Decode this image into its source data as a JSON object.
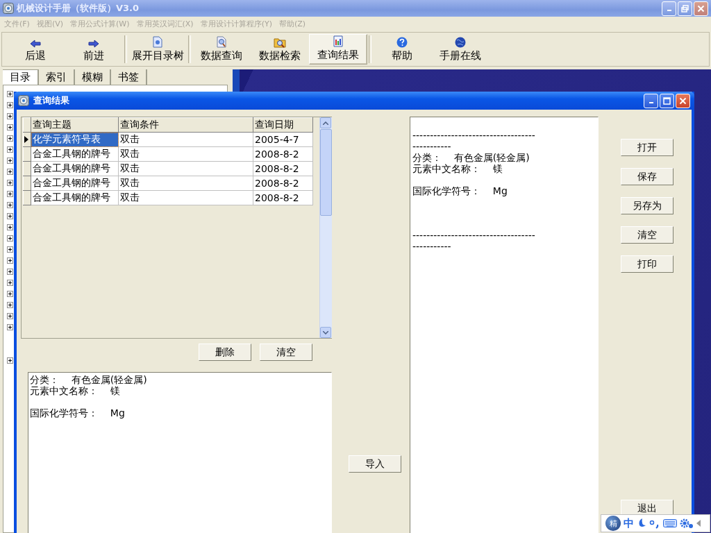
{
  "window": {
    "title": "机械设计手册（软件版）V3.0"
  },
  "menu": [
    {
      "label": "文件(F)",
      "disabled": true
    },
    {
      "label": "视图(V)",
      "disabled": true
    },
    {
      "label": "常用公式计算(W)",
      "disabled": true
    },
    {
      "label": "常用英汉词汇(X)",
      "disabled": true
    },
    {
      "label": "常用设计计算程序(Y)",
      "disabled": true
    },
    {
      "label": "帮助(Z)",
      "disabled": true
    }
  ],
  "toolbar": [
    {
      "label": "后退",
      "kind": "back",
      "selected": false,
      "separated": false
    },
    {
      "label": "前进",
      "kind": "forward",
      "selected": false,
      "separated": false
    },
    {
      "label": "展开目录树",
      "kind": "tree",
      "selected": false,
      "separated": true
    },
    {
      "label": "数据查询",
      "kind": "query",
      "selected": false,
      "separated": true
    },
    {
      "label": "数据检索",
      "kind": "search",
      "selected": false,
      "separated": false
    },
    {
      "label": "查询结果",
      "kind": "results",
      "selected": true,
      "separated": false
    },
    {
      "label": "帮助",
      "kind": "help",
      "selected": false,
      "separated": true
    },
    {
      "label": "手册在线",
      "kind": "online",
      "selected": false,
      "separated": false
    }
  ],
  "side_tabs": [
    {
      "label": "目录",
      "selected": true
    },
    {
      "label": "索引",
      "selected": false
    },
    {
      "label": "模糊",
      "selected": false
    },
    {
      "label": "书签",
      "selected": false
    }
  ],
  "tree": [
    {
      "kind": "node",
      "expanded": false
    },
    {
      "kind": "node",
      "expanded": false
    },
    {
      "kind": "node",
      "expanded": false
    },
    {
      "kind": "node",
      "expanded": false
    },
    {
      "kind": "node",
      "expanded": false
    },
    {
      "kind": "node",
      "expanded": false
    },
    {
      "kind": "node",
      "expanded": false
    },
    {
      "kind": "node",
      "expanded": false
    },
    {
      "kind": "node",
      "expanded": false
    },
    {
      "kind": "node",
      "expanded": false
    },
    {
      "kind": "node",
      "expanded": false
    },
    {
      "kind": "node",
      "expanded": false
    },
    {
      "kind": "node",
      "expanded": false
    },
    {
      "kind": "node",
      "expanded": false
    },
    {
      "kind": "node",
      "expanded": false
    },
    {
      "kind": "node",
      "expanded": false
    },
    {
      "kind": "node",
      "expanded": false
    },
    {
      "kind": "node",
      "expanded": false
    },
    {
      "kind": "node",
      "expanded": false
    },
    {
      "kind": "node",
      "expanded": false
    },
    {
      "kind": "node",
      "expanded": false
    },
    {
      "kind": "node",
      "expanded": false
    },
    {
      "kind": "leaf"
    },
    {
      "kind": "leaf"
    },
    {
      "kind": "node",
      "expanded": false
    }
  ],
  "dialog": {
    "title": "查询结果",
    "table": {
      "columns": [
        "查询主题",
        "查询条件",
        "查询日期"
      ],
      "rows": [
        {
          "cells": [
            "化学元素符号表",
            "双击",
            "2005-4-7"
          ],
          "selected": true
        },
        {
          "cells": [
            "合金工具钢的牌号",
            "双击",
            "2008-8-2"
          ],
          "selected": false
        },
        {
          "cells": [
            "合金工具钢的牌号",
            "双击",
            "2008-8-2"
          ],
          "selected": false
        },
        {
          "cells": [
            "合金工具钢的牌号",
            "双击",
            "2008-8-2"
          ],
          "selected": false
        },
        {
          "cells": [
            "合金工具钢的牌号",
            "双击",
            "2008-8-2"
          ],
          "selected": false
        }
      ]
    },
    "table_buttons": [
      "删除",
      "清空"
    ],
    "detail_lines": [
      {
        "text": "分类：    有色金属(轻金属)",
        "kind": "line"
      },
      {
        "text": "元素中文名称：    镁",
        "kind": "line"
      },
      {
        "text": "国际化学符号：    Mg",
        "kind": "spaced"
      }
    ],
    "import_button": "导入",
    "output_lines": [
      {
        "text": "-----------------------------------",
        "kind": "line"
      },
      {
        "text": "-----------",
        "kind": "line"
      },
      {
        "text": "分类：    有色金属(轻金属)",
        "kind": "line"
      },
      {
        "text": "元素中文名称：    镁",
        "kind": "line"
      },
      {
        "text": "国际化学符号：    Mg",
        "kind": "spaced"
      },
      {
        "text": "-----------------------------------",
        "kind": "section"
      },
      {
        "text": "-----------",
        "kind": "line"
      }
    ],
    "side_buttons": [
      "打开",
      "保存",
      "另存为",
      "清空",
      "打印"
    ],
    "exit_button": "退出"
  },
  "ime": {
    "logo": "精",
    "mode": "中"
  }
}
